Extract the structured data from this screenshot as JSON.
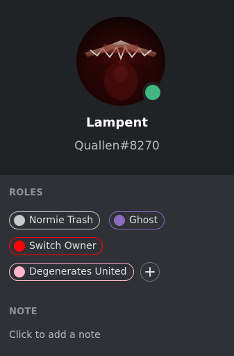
{
  "profile": {
    "username": "Lampent",
    "tag": "Quallen#8270",
    "status_color": "#43b581"
  },
  "roles_section": {
    "title": "ROLES",
    "roles": [
      {
        "name": "Normie Trash",
        "color": "#c8c8c8"
      },
      {
        "name": "Ghost",
        "color": "#8c6bbf"
      },
      {
        "name": "Switch Owner",
        "color": "#ff0000"
      },
      {
        "name": "Degenerates United",
        "color": "#ffb6c8"
      }
    ]
  },
  "note_section": {
    "title": "NOTE",
    "placeholder": "Click to add a note"
  },
  "colors": {
    "header_bg": "#202225",
    "body_bg": "#2f3136",
    "muted_text": "#8e9297"
  }
}
